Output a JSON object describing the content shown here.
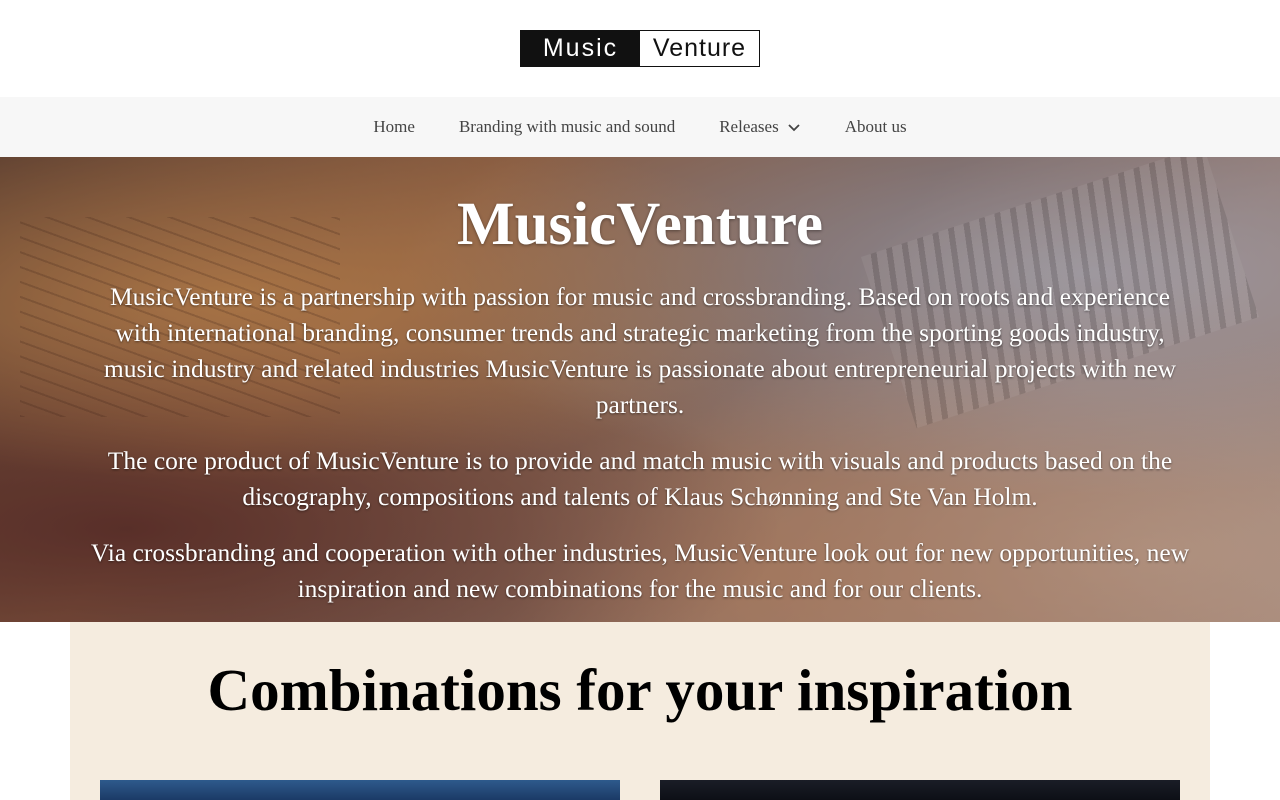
{
  "header": {
    "logo_left": "Music",
    "logo_right": "Venture"
  },
  "nav": {
    "items": [
      {
        "label": "Home"
      },
      {
        "label": "Branding with music and sound"
      },
      {
        "label": "Releases",
        "icon": "chevron-down-icon"
      },
      {
        "label": "About us"
      }
    ]
  },
  "hero": {
    "title": "MusicVenture",
    "paragraphs": [
      "MusicVenture is a partnership with passion for music and crossbranding. Based on roots and experience with international branding, consumer trends and strategic marketing from the sporting goods industry, music industry and related industries MusicVenture is passionate about entrepreneurial projects with new partners.",
      "The core product of MusicVenture is to provide and match music with visuals and products based on the discography, compositions and talents of Klaus Schønning and Ste Van Holm.",
      "Via crossbranding and cooperation with other industries, MusicVenture look out for new opportunities, new inspiration and new combinations for the music and for our clients."
    ]
  },
  "section": {
    "title": "Combinations for your inspiration"
  },
  "colors": {
    "nav_bg": "#f7f7f7",
    "section_bg": "#f5ecdf",
    "hero_text": "#ffffff"
  }
}
